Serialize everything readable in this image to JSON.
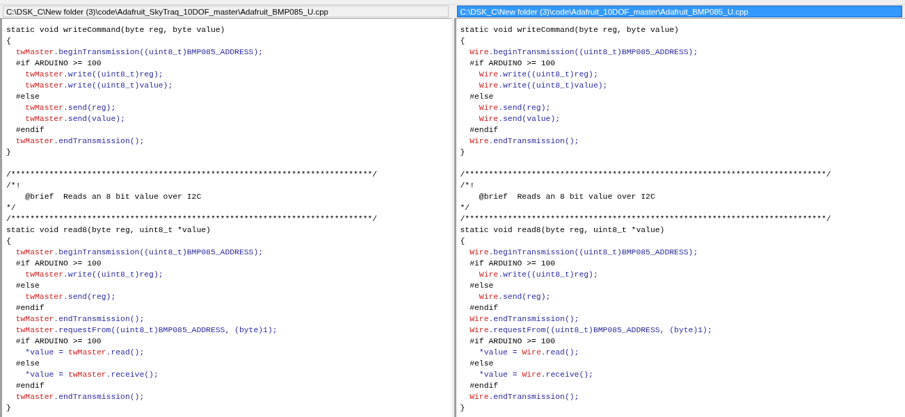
{
  "panes": [
    {
      "path": "C:\\DSK_C\\New folder (3)\\code\\Adafruit_SkyTraq_10DOF_master\\Adafruit_BMP085_U.cpp",
      "selected": false,
      "lines": [
        {
          "kind": "same",
          "parts": [
            {
              "text": "static void writeCommand(byte reg, byte value)",
              "changed": false
            }
          ]
        },
        {
          "kind": "same",
          "parts": [
            {
              "text": "{",
              "changed": false
            }
          ]
        },
        {
          "kind": "changed",
          "parts": [
            {
              "text": "  twMaster",
              "changed": true
            },
            {
              "text": ".beginTransmission((uint8_t)BMP085_ADDRESS);",
              "changed": false
            }
          ]
        },
        {
          "kind": "same",
          "parts": [
            {
              "text": "  #if ARDUINO >= 100",
              "changed": false
            }
          ]
        },
        {
          "kind": "changed",
          "parts": [
            {
              "text": "    twMaster",
              "changed": true
            },
            {
              "text": ".write((uint8_t)reg);",
              "changed": false
            }
          ]
        },
        {
          "kind": "changed",
          "parts": [
            {
              "text": "    twMaster",
              "changed": true
            },
            {
              "text": ".write((uint8_t)value);",
              "changed": false
            }
          ]
        },
        {
          "kind": "same",
          "parts": [
            {
              "text": "  #else",
              "changed": false
            }
          ]
        },
        {
          "kind": "changed",
          "parts": [
            {
              "text": "    twMaster",
              "changed": true
            },
            {
              "text": ".send(reg);",
              "changed": false
            }
          ]
        },
        {
          "kind": "changed",
          "parts": [
            {
              "text": "    twMaster",
              "changed": true
            },
            {
              "text": ".send(value);",
              "changed": false
            }
          ]
        },
        {
          "kind": "same",
          "parts": [
            {
              "text": "  #endif",
              "changed": false
            }
          ]
        },
        {
          "kind": "changed",
          "parts": [
            {
              "text": "  twMaster",
              "changed": true
            },
            {
              "text": ".endTransmission();",
              "changed": false
            }
          ]
        },
        {
          "kind": "same",
          "parts": [
            {
              "text": "}",
              "changed": false
            }
          ]
        },
        {
          "kind": "blank"
        },
        {
          "kind": "same",
          "parts": [
            {
              "text": "/****************************************************************************/",
              "changed": false
            }
          ]
        },
        {
          "kind": "same",
          "parts": [
            {
              "text": "/*!",
              "changed": false
            }
          ]
        },
        {
          "kind": "same",
          "parts": [
            {
              "text": "    @brief  Reads an 8 bit value over I2C",
              "changed": false
            }
          ]
        },
        {
          "kind": "same",
          "parts": [
            {
              "text": "*/",
              "changed": false
            }
          ]
        },
        {
          "kind": "same",
          "parts": [
            {
              "text": "/****************************************************************************/",
              "changed": false
            }
          ]
        },
        {
          "kind": "same",
          "parts": [
            {
              "text": "static void read8(byte reg, uint8_t *value)",
              "changed": false
            }
          ]
        },
        {
          "kind": "same",
          "parts": [
            {
              "text": "{",
              "changed": false
            }
          ]
        },
        {
          "kind": "changed",
          "parts": [
            {
              "text": "  twMaster",
              "changed": true
            },
            {
              "text": ".beginTransmission((uint8_t)BMP085_ADDRESS);",
              "changed": false
            }
          ]
        },
        {
          "kind": "same",
          "parts": [
            {
              "text": "  #if ARDUINO >= 100",
              "changed": false
            }
          ]
        },
        {
          "kind": "changed",
          "parts": [
            {
              "text": "    twMaster",
              "changed": true
            },
            {
              "text": ".write((uint8_t)reg);",
              "changed": false
            }
          ]
        },
        {
          "kind": "same",
          "parts": [
            {
              "text": "  #else",
              "changed": false
            }
          ]
        },
        {
          "kind": "changed",
          "parts": [
            {
              "text": "    twMaster",
              "changed": true
            },
            {
              "text": ".send(reg);",
              "changed": false
            }
          ]
        },
        {
          "kind": "same",
          "parts": [
            {
              "text": "  #endif",
              "changed": false
            }
          ]
        },
        {
          "kind": "changed",
          "parts": [
            {
              "text": "  twMaster",
              "changed": true
            },
            {
              "text": ".endTransmission();",
              "changed": false
            }
          ]
        },
        {
          "kind": "changed",
          "parts": [
            {
              "text": "  twMaster",
              "changed": true
            },
            {
              "text": ".requestFrom((uint8_t)BMP085_ADDRESS, (byte)1);",
              "changed": false
            }
          ]
        },
        {
          "kind": "same",
          "parts": [
            {
              "text": "  #if ARDUINO >= 100",
              "changed": false
            }
          ]
        },
        {
          "kind": "changed",
          "parts": [
            {
              "text": "    *value = ",
              "changed": false
            },
            {
              "text": "twMaster",
              "changed": true
            },
            {
              "text": ".read();",
              "changed": false
            }
          ]
        },
        {
          "kind": "same",
          "parts": [
            {
              "text": "  #else",
              "changed": false
            }
          ]
        },
        {
          "kind": "changed",
          "parts": [
            {
              "text": "    *value = ",
              "changed": false
            },
            {
              "text": "twMaster",
              "changed": true
            },
            {
              "text": ".receive();",
              "changed": false
            }
          ]
        },
        {
          "kind": "same",
          "parts": [
            {
              "text": "  #endif",
              "changed": false
            }
          ]
        },
        {
          "kind": "changed",
          "parts": [
            {
              "text": "  twMaster",
              "changed": true
            },
            {
              "text": ".endTransmission();",
              "changed": false
            }
          ]
        },
        {
          "kind": "same",
          "parts": [
            {
              "text": "}",
              "changed": false
            }
          ]
        }
      ]
    },
    {
      "path": "C:\\DSK_C\\New folder (3)\\code\\Adafruit_10DOF_master\\Adafruit_BMP085_U.cpp",
      "selected": true,
      "lines": [
        {
          "kind": "same",
          "parts": [
            {
              "text": "static void writeCommand(byte reg, byte value)",
              "changed": false
            }
          ]
        },
        {
          "kind": "same",
          "parts": [
            {
              "text": "{",
              "changed": false
            }
          ]
        },
        {
          "kind": "changed",
          "parts": [
            {
              "text": "  Wire",
              "changed": true
            },
            {
              "text": ".beginTransmission((uint8_t)BMP085_ADDRESS);",
              "changed": false
            }
          ]
        },
        {
          "kind": "same",
          "parts": [
            {
              "text": "  #if ARDUINO >= 100",
              "changed": false
            }
          ]
        },
        {
          "kind": "changed",
          "parts": [
            {
              "text": "    Wire",
              "changed": true
            },
            {
              "text": ".write((uint8_t)reg);",
              "changed": false
            }
          ]
        },
        {
          "kind": "changed",
          "parts": [
            {
              "text": "    Wire",
              "changed": true
            },
            {
              "text": ".write((uint8_t)value);",
              "changed": false
            }
          ]
        },
        {
          "kind": "same",
          "parts": [
            {
              "text": "  #else",
              "changed": false
            }
          ]
        },
        {
          "kind": "changed",
          "parts": [
            {
              "text": "    Wire",
              "changed": true
            },
            {
              "text": ".send(reg);",
              "changed": false
            }
          ]
        },
        {
          "kind": "changed",
          "parts": [
            {
              "text": "    Wire",
              "changed": true
            },
            {
              "text": ".send(value);",
              "changed": false
            }
          ]
        },
        {
          "kind": "same",
          "parts": [
            {
              "text": "  #endif",
              "changed": false
            }
          ]
        },
        {
          "kind": "changed",
          "parts": [
            {
              "text": "  Wire",
              "changed": true
            },
            {
              "text": ".endTransmission();",
              "changed": false
            }
          ]
        },
        {
          "kind": "same",
          "parts": [
            {
              "text": "}",
              "changed": false
            }
          ]
        },
        {
          "kind": "blank"
        },
        {
          "kind": "same",
          "parts": [
            {
              "text": "/****************************************************************************/",
              "changed": false
            }
          ]
        },
        {
          "kind": "same",
          "parts": [
            {
              "text": "/*!",
              "changed": false
            }
          ]
        },
        {
          "kind": "same",
          "parts": [
            {
              "text": "    @brief  Reads an 8 bit value over I2C",
              "changed": false
            }
          ]
        },
        {
          "kind": "same",
          "parts": [
            {
              "text": "*/",
              "changed": false
            }
          ]
        },
        {
          "kind": "same",
          "parts": [
            {
              "text": "/****************************************************************************/",
              "changed": false
            }
          ]
        },
        {
          "kind": "same",
          "parts": [
            {
              "text": "static void read8(byte reg, uint8_t *value)",
              "changed": false
            }
          ]
        },
        {
          "kind": "same",
          "parts": [
            {
              "text": "{",
              "changed": false
            }
          ]
        },
        {
          "kind": "changed",
          "parts": [
            {
              "text": "  Wire",
              "changed": true
            },
            {
              "text": ".beginTransmission((uint8_t)BMP085_ADDRESS);",
              "changed": false
            }
          ]
        },
        {
          "kind": "same",
          "parts": [
            {
              "text": "  #if ARDUINO >= 100",
              "changed": false
            }
          ]
        },
        {
          "kind": "changed",
          "parts": [
            {
              "text": "    Wire",
              "changed": true
            },
            {
              "text": ".write((uint8_t)reg);",
              "changed": false
            }
          ]
        },
        {
          "kind": "same",
          "parts": [
            {
              "text": "  #else",
              "changed": false
            }
          ]
        },
        {
          "kind": "changed",
          "parts": [
            {
              "text": "    Wire",
              "changed": true
            },
            {
              "text": ".send(reg);",
              "changed": false
            }
          ]
        },
        {
          "kind": "same",
          "parts": [
            {
              "text": "  #endif",
              "changed": false
            }
          ]
        },
        {
          "kind": "changed",
          "parts": [
            {
              "text": "  Wire",
              "changed": true
            },
            {
              "text": ".endTransmission();",
              "changed": false
            }
          ]
        },
        {
          "kind": "changed",
          "parts": [
            {
              "text": "  Wire",
              "changed": true
            },
            {
              "text": ".requestFrom((uint8_t)BMP085_ADDRESS, (byte)1);",
              "changed": false
            }
          ]
        },
        {
          "kind": "same",
          "parts": [
            {
              "text": "  #if ARDUINO >= 100",
              "changed": false
            }
          ]
        },
        {
          "kind": "changed",
          "parts": [
            {
              "text": "    *value = ",
              "changed": false
            },
            {
              "text": "Wire",
              "changed": true
            },
            {
              "text": ".read();",
              "changed": false
            }
          ]
        },
        {
          "kind": "same",
          "parts": [
            {
              "text": "  #else",
              "changed": false
            }
          ]
        },
        {
          "kind": "changed",
          "parts": [
            {
              "text": "    *value = ",
              "changed": false
            },
            {
              "text": "Wire",
              "changed": true
            },
            {
              "text": ".receive();",
              "changed": false
            }
          ]
        },
        {
          "kind": "same",
          "parts": [
            {
              "text": "  #endif",
              "changed": false
            }
          ]
        },
        {
          "kind": "changed",
          "parts": [
            {
              "text": "  Wire",
              "changed": true
            },
            {
              "text": ".endTransmission();",
              "changed": false
            }
          ]
        },
        {
          "kind": "same",
          "parts": [
            {
              "text": "}",
              "changed": false
            }
          ]
        }
      ]
    }
  ]
}
